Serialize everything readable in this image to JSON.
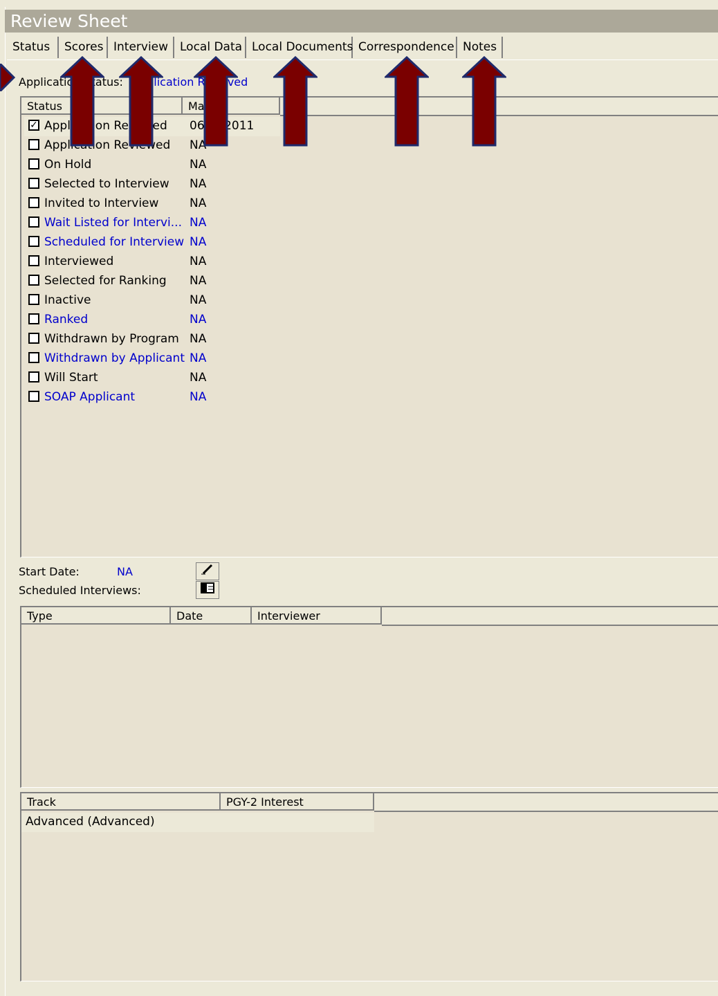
{
  "window": {
    "title": "Review Sheet"
  },
  "tabs": [
    {
      "label": "Status",
      "active": true
    },
    {
      "label": "Scores",
      "active": false
    },
    {
      "label": "Interview",
      "active": false
    },
    {
      "label": "Local Data",
      "active": false
    },
    {
      "label": "Local Documents",
      "active": false
    },
    {
      "label": "Correspondence",
      "active": false
    },
    {
      "label": "Notes",
      "active": false
    }
  ],
  "application_status": {
    "label": "Application Status:",
    "value": "Application Received"
  },
  "status_list": {
    "headers": [
      "Status",
      "Marked"
    ],
    "rows": [
      {
        "status": "Application Received",
        "date": "06/__/2011",
        "checked": true,
        "color": "black"
      },
      {
        "status": "Application Reviewed",
        "date": "NA",
        "checked": false,
        "color": "black"
      },
      {
        "status": "On Hold",
        "date": "NA",
        "checked": false,
        "color": "black"
      },
      {
        "status": "Selected to Interview",
        "date": "NA",
        "checked": false,
        "color": "black"
      },
      {
        "status": "Invited to Interview",
        "date": "NA",
        "checked": false,
        "color": "black"
      },
      {
        "status": "Wait Listed for Intervi...",
        "date": "NA",
        "checked": false,
        "color": "blue"
      },
      {
        "status": "Scheduled for Interview",
        "date": "NA",
        "checked": false,
        "color": "blue"
      },
      {
        "status": "Interviewed",
        "date": "NA",
        "checked": false,
        "color": "black"
      },
      {
        "status": "Selected for Ranking",
        "date": "NA",
        "checked": false,
        "color": "black"
      },
      {
        "status": "Inactive",
        "date": "NA",
        "checked": false,
        "color": "black"
      },
      {
        "status": "Ranked",
        "date": "NA",
        "checked": false,
        "color": "blue"
      },
      {
        "status": "Withdrawn by Program",
        "date": "NA",
        "checked": false,
        "color": "black"
      },
      {
        "status": "Withdrawn by Applicant",
        "date": "NA",
        "checked": false,
        "color": "blue"
      },
      {
        "status": "Will Start",
        "date": "NA",
        "checked": false,
        "color": "black"
      },
      {
        "status": "SOAP Applicant",
        "date": "NA",
        "checked": false,
        "color": "blue"
      }
    ]
  },
  "start_date": {
    "label": "Start Date:",
    "value": "NA",
    "edit_icon": "pencil-icon"
  },
  "scheduled_interviews": {
    "label": "Scheduled Interviews:",
    "schedule_icon": "calendar-icon",
    "headers": [
      "Type",
      "Date",
      "Interviewer"
    ]
  },
  "track": {
    "headers": [
      "Track",
      "PGY-2 Interest"
    ],
    "rows": [
      {
        "track": "Advanced (Advanced)",
        "pgy2": ""
      }
    ]
  },
  "colors": {
    "link_blue": "#0000cc",
    "arrow_fill": "#7a0000",
    "arrow_outline": "#1f2a6b",
    "title_bar": "#aca899"
  }
}
